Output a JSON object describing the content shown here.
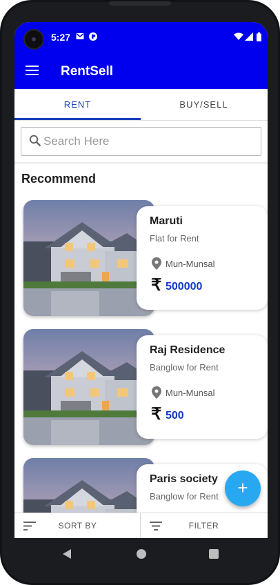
{
  "status_bar": {
    "time": "5:27",
    "left_icons": [
      "mail-icon",
      "sync-icon"
    ],
    "right_icons": [
      "wifi-icon",
      "signal-icon",
      "battery-icon"
    ]
  },
  "app_bar": {
    "title": "RentSell",
    "menu_icon": "menu-icon"
  },
  "tabs": [
    {
      "label": "RENT",
      "active": true
    },
    {
      "label": "BUY/SELL",
      "active": false
    }
  ],
  "search": {
    "placeholder": "Search Here",
    "value": ""
  },
  "section": {
    "title": "Recommend"
  },
  "listings": [
    {
      "name": "Maruti",
      "type": "Flat for Rent",
      "location": "Mun-Munsal",
      "currency": "₹",
      "price": "500000"
    },
    {
      "name": "Raj Residence",
      "type": "Banglow for Rent",
      "location": "Mun-Munsal",
      "currency": "₹",
      "price": "500"
    },
    {
      "name": "Paris society",
      "type": "Banglow for Rent",
      "location": "",
      "currency": "",
      "price": ""
    }
  ],
  "fab": {
    "label": "+"
  },
  "bottom_bar": {
    "sort_label": "SORT BY",
    "filter_label": "FILTER"
  },
  "colors": {
    "primary": "#0000ee",
    "tab_active": "#1b3fbd",
    "price": "#1238c9",
    "fab": "#29a8f2"
  }
}
